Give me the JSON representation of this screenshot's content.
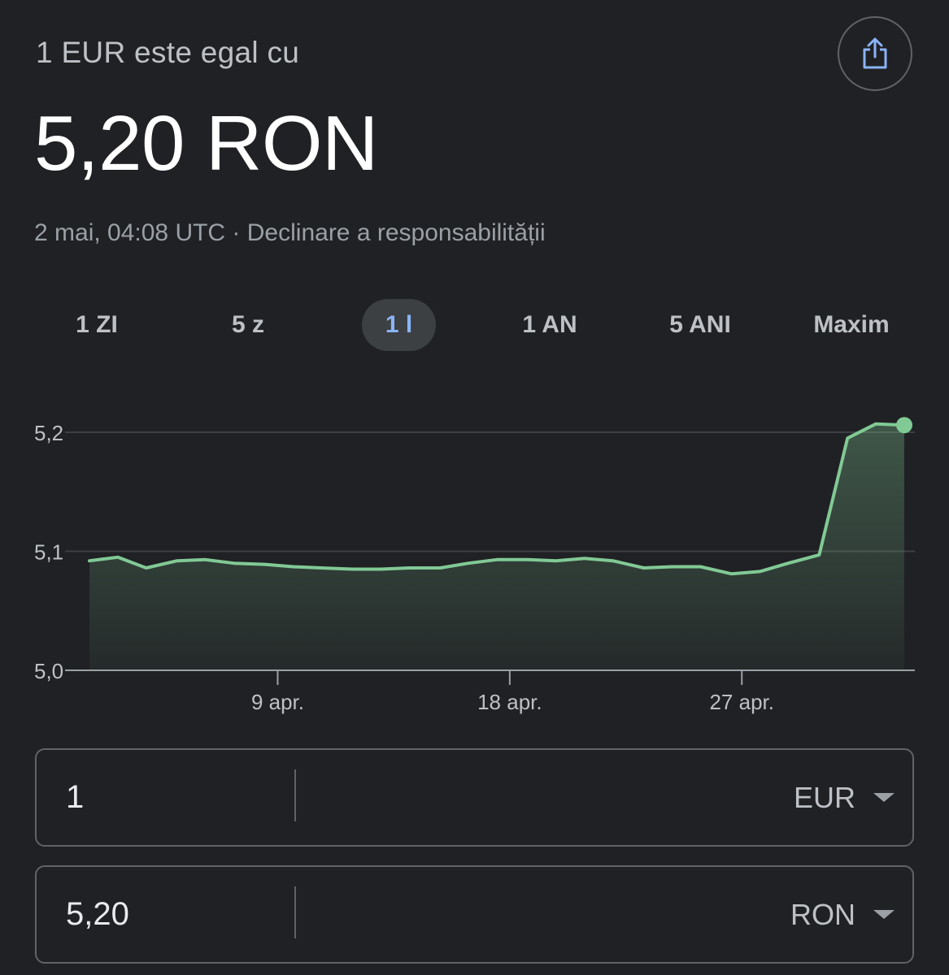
{
  "header": {
    "subtitle": "1 EUR este egal cu",
    "rate": "5,20 RON",
    "timestamp": "2 mai, 04:08 UTC",
    "separator": " · ",
    "disclaimer": "Declinare a responsabilității",
    "share_icon": "share-icon"
  },
  "tabs": [
    {
      "label": "1 ZI",
      "active": false
    },
    {
      "label": "5 z",
      "active": false
    },
    {
      "label": "1 l",
      "active": true
    },
    {
      "label": "1 AN",
      "active": false
    },
    {
      "label": "5 ANI",
      "active": false
    },
    {
      "label": "Maxim",
      "active": false
    }
  ],
  "colors": {
    "background": "#202124",
    "line": "#81c995",
    "accent_tab": "#8ab4f8"
  },
  "chart_data": {
    "type": "area",
    "x_tick_labels": [
      "9 apr.",
      "18 apr.",
      "27 apr."
    ],
    "x_tick_positions": [
      7.3,
      16.3,
      25.3
    ],
    "y_ticks": [
      "5,0",
      "5,1",
      "5,2"
    ],
    "y_tick_values": [
      5.0,
      5.1,
      5.2
    ],
    "ylim": [
      5.0,
      5.2
    ],
    "xlim": [
      0,
      31.6
    ],
    "x": [
      0,
      1.1,
      2.2,
      3.4,
      4.5,
      5.6,
      6.8,
      7.9,
      9.0,
      10.2,
      11.3,
      12.4,
      13.6,
      14.7,
      15.8,
      17.0,
      18.1,
      19.2,
      20.3,
      21.5,
      22.6,
      23.7,
      24.9,
      26.0,
      27.1,
      28.3,
      29.4,
      30.5,
      31.6
    ],
    "values": [
      5.092,
      5.095,
      5.086,
      5.092,
      5.093,
      5.09,
      5.089,
      5.087,
      5.086,
      5.085,
      5.085,
      5.086,
      5.086,
      5.09,
      5.093,
      5.093,
      5.092,
      5.094,
      5.092,
      5.086,
      5.087,
      5.087,
      5.081,
      5.083,
      5.09,
      5.097,
      5.195,
      5.207,
      5.206
    ],
    "grid": true,
    "legend": "none",
    "end_marker": true
  },
  "converter": {
    "from": {
      "amount": "1",
      "currency": "EUR"
    },
    "to": {
      "amount": "5,20",
      "currency": "RON"
    }
  }
}
